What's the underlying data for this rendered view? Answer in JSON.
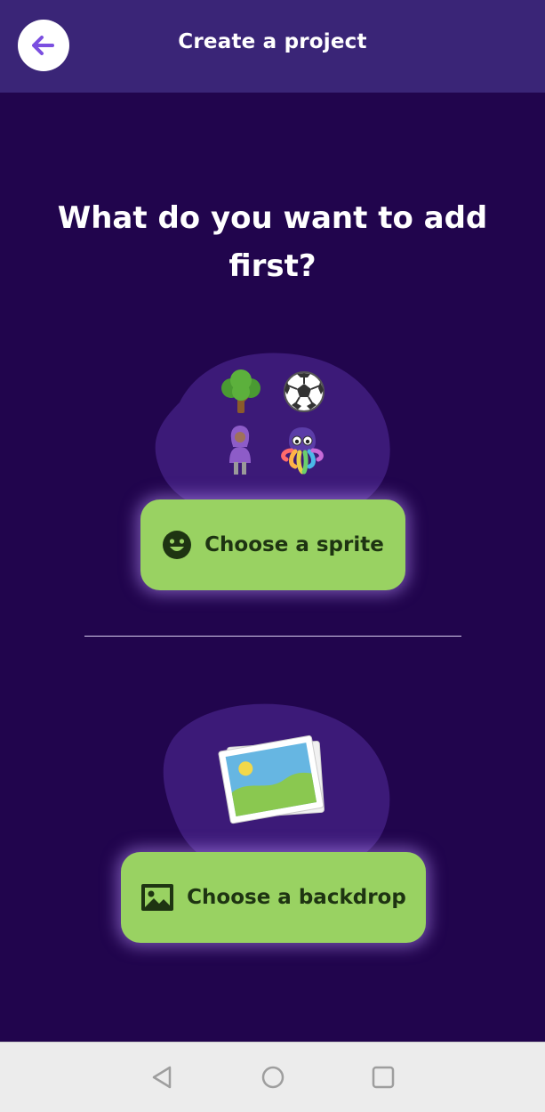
{
  "header": {
    "title": "Create a project",
    "back_icon": "arrow-left-icon"
  },
  "main": {
    "question": "What do you want to add first?",
    "sprite_section": {
      "icons": [
        "tree-icon",
        "soccer-ball-icon",
        "person-icon",
        "octopus-icon"
      ],
      "button_label": "Choose a sprite",
      "button_icon": "smiley-face-icon"
    },
    "backdrop_section": {
      "illustration": "photo-stack-icon",
      "button_label": "Choose a backdrop",
      "button_icon": "image-icon"
    }
  },
  "system_nav": {
    "buttons": [
      "back-triangle-icon",
      "home-circle-icon",
      "recents-square-icon"
    ]
  },
  "colors": {
    "background": "#21054d",
    "header": "#3a2577",
    "blob": "#3c1a78",
    "button": "#99d262",
    "button_text": "#1e3412",
    "accent": "#7b4fe0"
  }
}
